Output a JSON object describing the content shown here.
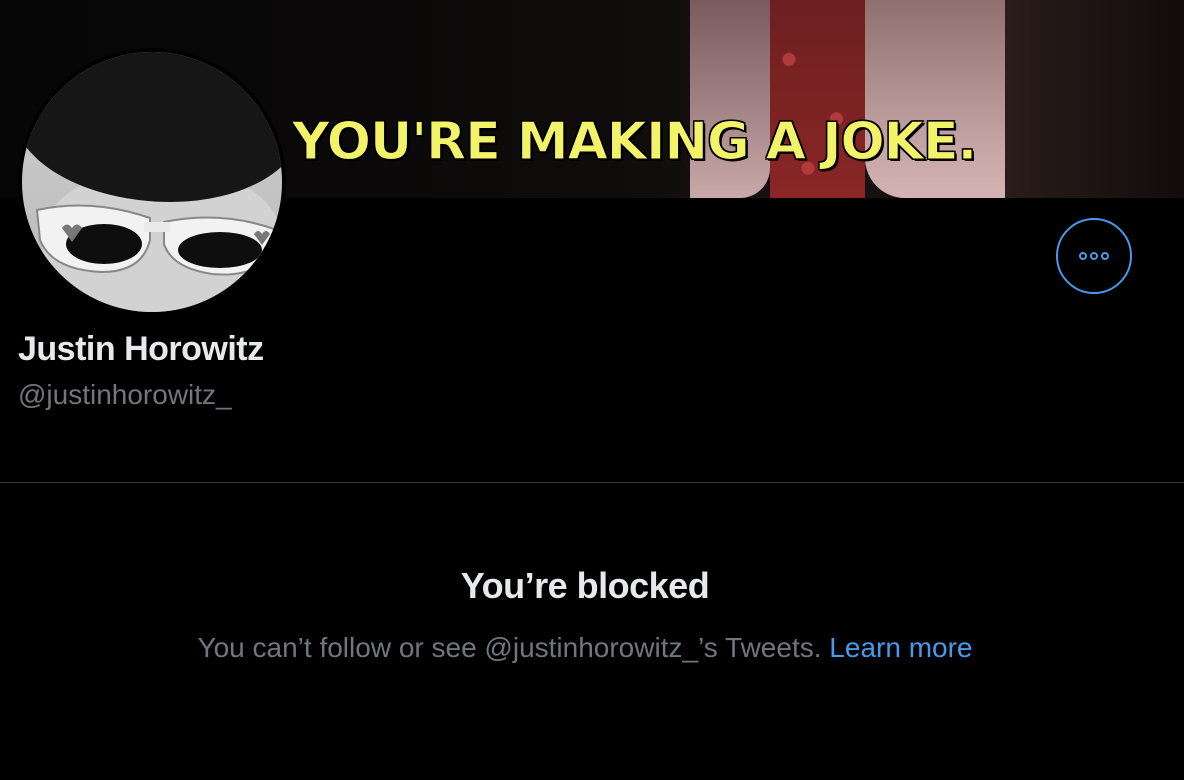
{
  "banner": {
    "subtitle_text": "YOU'RE MAKING A JOKE."
  },
  "profile": {
    "display_name": "Justin Horowitz",
    "handle": "@justinhorowitz_"
  },
  "actions": {
    "more_icon": "more-horizontal-icon"
  },
  "blocked": {
    "title": "You’re blocked",
    "description": "You can’t follow or see @justinhorowitz_’s Tweets.",
    "learn_more": "Learn more"
  },
  "colors": {
    "accent": "#4a99e9",
    "background": "#000000",
    "primary_text": "#e7e9ea",
    "secondary_text": "#71767b"
  }
}
